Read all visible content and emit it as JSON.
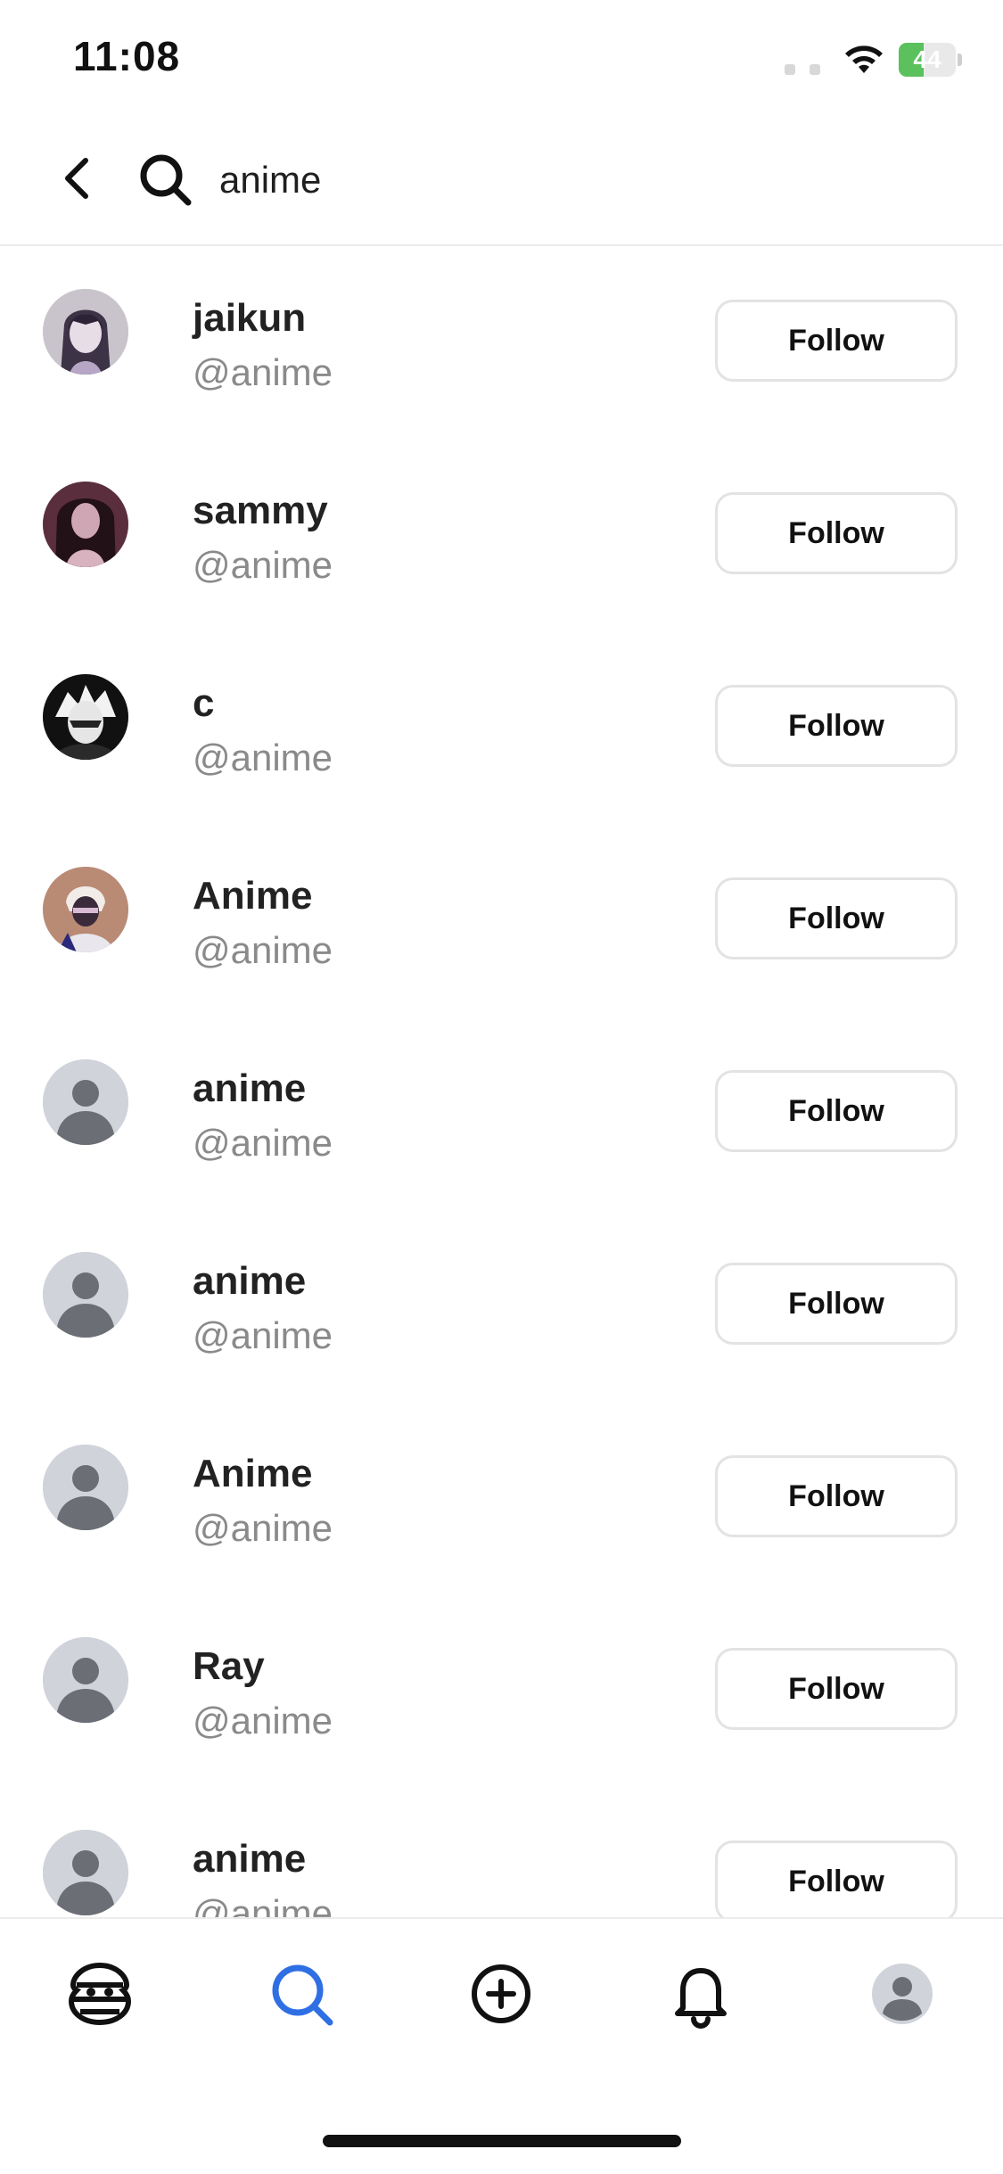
{
  "status_bar": {
    "time": "11:08",
    "battery_percent": 44,
    "battery_label": "44",
    "icons": [
      "signal-icon",
      "wifi-icon",
      "battery-icon"
    ]
  },
  "search": {
    "query": "anime",
    "back_icon": "chevron-left-icon",
    "search_icon": "search-icon"
  },
  "results": [
    {
      "name": "jaikun",
      "handle": "@anime",
      "avatar": "photo",
      "follow_label": "Follow"
    },
    {
      "name": "sammy",
      "handle": "@anime",
      "avatar": "photo",
      "follow_label": "Follow"
    },
    {
      "name": "c",
      "handle": "@anime",
      "avatar": "photo",
      "follow_label": "Follow"
    },
    {
      "name": "Anime",
      "handle": "@anime",
      "avatar": "photo",
      "follow_label": "Follow"
    },
    {
      "name": "anime",
      "handle": "@anime",
      "avatar": "default",
      "follow_label": "Follow"
    },
    {
      "name": "anime",
      "handle": "@anime",
      "avatar": "default",
      "follow_label": "Follow"
    },
    {
      "name": "Anime",
      "handle": "@anime",
      "avatar": "default",
      "follow_label": "Follow"
    },
    {
      "name": "Ray",
      "handle": "@anime",
      "avatar": "default",
      "follow_label": "Follow"
    },
    {
      "name": "anime",
      "handle": "@anime",
      "avatar": "default",
      "follow_label": "Follow"
    }
  ],
  "tab_bar": {
    "tabs": [
      {
        "icon": "home-icon",
        "active": false
      },
      {
        "icon": "search-icon",
        "active": true
      },
      {
        "icon": "add-icon",
        "active": false
      },
      {
        "icon": "bell-icon",
        "active": false
      },
      {
        "icon": "profile-avatar-icon",
        "active": false
      }
    ],
    "active_color": "#2f6fe4",
    "inactive_color": "#111111"
  },
  "colors": {
    "battery_fill": "#5ac15c",
    "handle_text": "#8a8a8a",
    "button_border": "#e3e3e3",
    "default_avatar_bg": "#d0d3da"
  }
}
